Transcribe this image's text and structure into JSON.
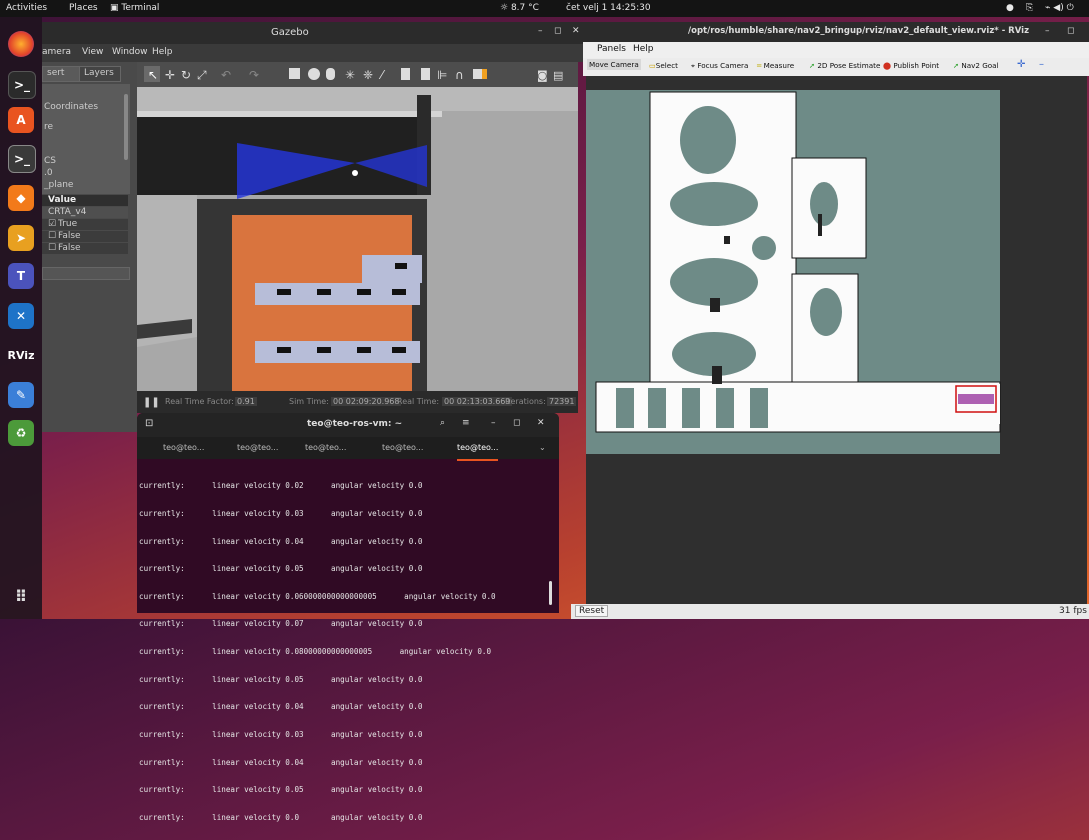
{
  "topbar": {
    "activities": "Activities",
    "places": "Places",
    "terminal": "Terminal",
    "weather": "8.7 °C",
    "clock": "čet velj 1  14:25:30"
  },
  "dock": {
    "apps": [
      "firefox-icon",
      "terminal-icon",
      "appcenter-icon",
      "sublime-icon",
      "tool-icon",
      "teams-icon",
      "vscode-icon",
      "rviz-icon",
      "editor-icon",
      "trash-icon"
    ],
    "rviz_text": "RViz"
  },
  "gazebo": {
    "title": "Gazebo",
    "menu": [
      "amera",
      "View",
      "Window",
      "Help"
    ],
    "left_tabs": [
      "sert",
      "Layers"
    ],
    "left_items": [
      "Coordinates",
      "re",
      "CS",
      ".0",
      "_plane"
    ],
    "prop_header": "Value",
    "prop_rows": [
      "CRTA_v4",
      "True",
      "False",
      "False"
    ],
    "status": {
      "rtf_label": "Real Time Factor:",
      "rtf_value": "0.91",
      "sim_label": "Sim Time:",
      "sim_value": "00 02:09:20.968",
      "real_label": "Real Time:",
      "real_value": "00 02:13:03.669",
      "iter_label": "Iterations:",
      "iter_value": "72391"
    }
  },
  "terminal": {
    "title": "teo@teo-ros-vm: ~",
    "tabs": [
      "teo@teo...",
      "teo@teo...",
      "teo@teo...",
      "teo@teo...",
      "teo@teo..."
    ],
    "lines": [
      "currently:      linear velocity 0.02      angular velocity 0.0",
      "currently:      linear velocity 0.03      angular velocity 0.0",
      "currently:      linear velocity 0.04      angular velocity 0.0",
      "currently:      linear velocity 0.05      angular velocity 0.0",
      "currently:      linear velocity 0.060000000000000005      angular velocity 0.0",
      "currently:      linear velocity 0.07      angular velocity 0.0",
      "currently:      linear velocity 0.08000000000000005      angular velocity 0.0",
      "currently:      linear velocity 0.05      angular velocity 0.0",
      "currently:      linear velocity 0.04      angular velocity 0.0",
      "currently:      linear velocity 0.03      angular velocity 0.0",
      "currently:      linear velocity 0.04      angular velocity 0.0",
      "currently:      linear velocity 0.05      angular velocity 0.0",
      "currently:      linear velocity 0.0       angular velocity 0.0"
    ]
  },
  "rviz": {
    "title": "/opt/ros/humble/share/nav2_bringup/rviz/nav2_default_view.rviz* - RViz",
    "menu": [
      "Panels",
      "Help"
    ],
    "tools": [
      "Move Camera",
      "Select",
      "Focus Camera",
      "Measure",
      "2D Pose Estimate",
      "Publish Point",
      "Nav2 Goal"
    ],
    "reset": "Reset",
    "fps": "31 fps"
  },
  "colors": {
    "rviz_bg": "#6e8b87",
    "laser_blue": "#2436e0",
    "floor_orange": "#d9743e"
  }
}
